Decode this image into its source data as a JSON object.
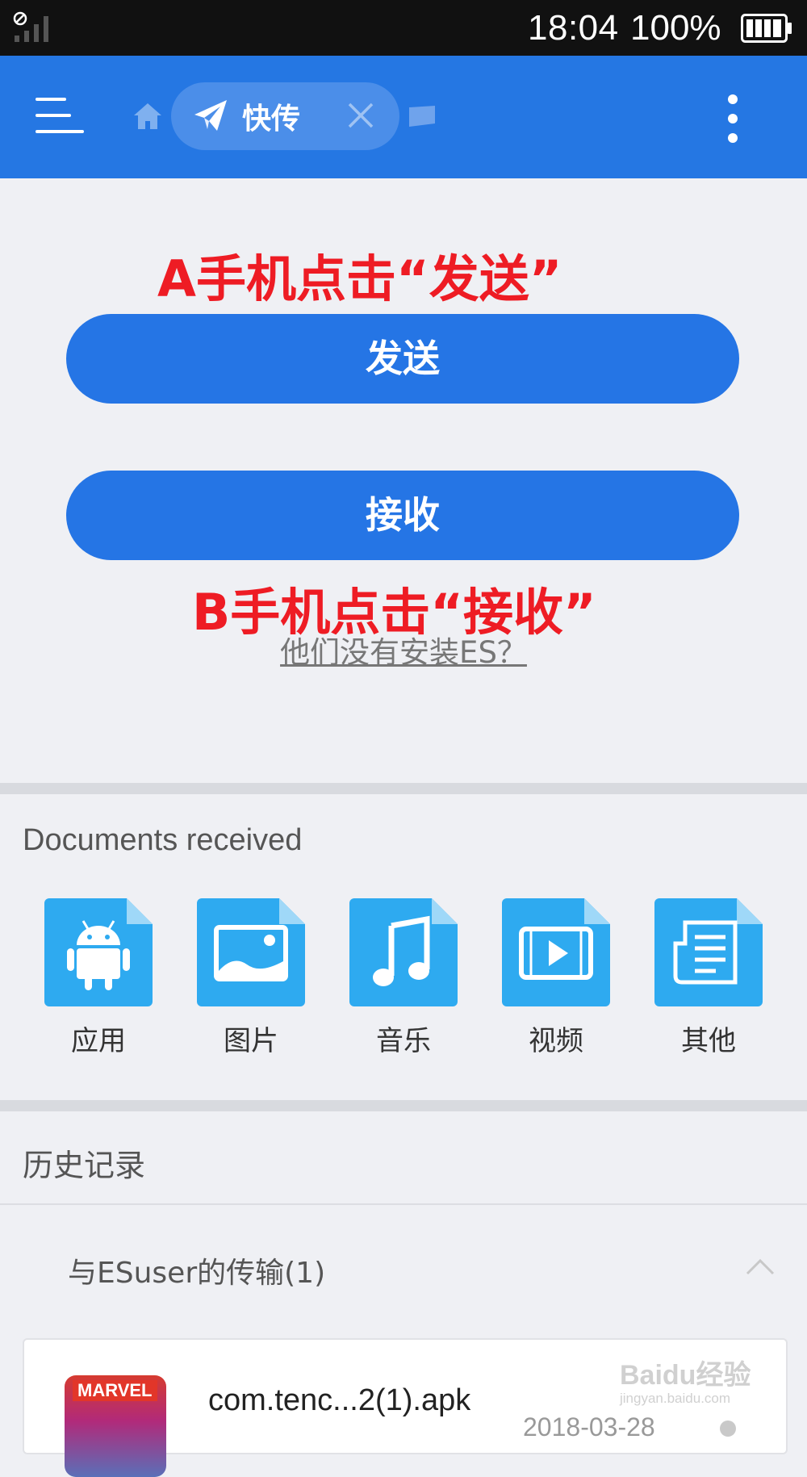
{
  "status_bar": {
    "time": "18:04",
    "battery": "100%"
  },
  "toolbar": {
    "tab_label": "快传",
    "icons": [
      "menu-icon",
      "home-icon",
      "paper-plane-icon",
      "close-icon",
      "card-icon",
      "more-vert-icon"
    ]
  },
  "main": {
    "annotation_a": "A手机点击“发送”",
    "send_button": "发送",
    "receive_button": "接收",
    "annotation_b": "B手机点击“接收”",
    "no_es_link": "他们没有安装ES？"
  },
  "documents": {
    "title": "Documents received",
    "categories": [
      {
        "label": "应用",
        "icon": "android-icon"
      },
      {
        "label": "图片",
        "icon": "image-icon"
      },
      {
        "label": "音乐",
        "icon": "music-icon"
      },
      {
        "label": "视频",
        "icon": "video-icon"
      },
      {
        "label": "其他",
        "icon": "document-icon"
      }
    ]
  },
  "history": {
    "title": "历史记录",
    "group": "与ESuser的传输(1)",
    "files": [
      {
        "name": "com.tenc...2(1).apk",
        "date": "2018-03-28",
        "icon_text": "MARVEL"
      }
    ]
  },
  "watermark": {
    "main": "Baidu经验",
    "sub": "jingyan.baidu.com"
  },
  "colors": {
    "accent": "#2577e3",
    "button": "#2575e5",
    "annotation": "#ee1c24",
    "folder": "#2eaaf0"
  }
}
